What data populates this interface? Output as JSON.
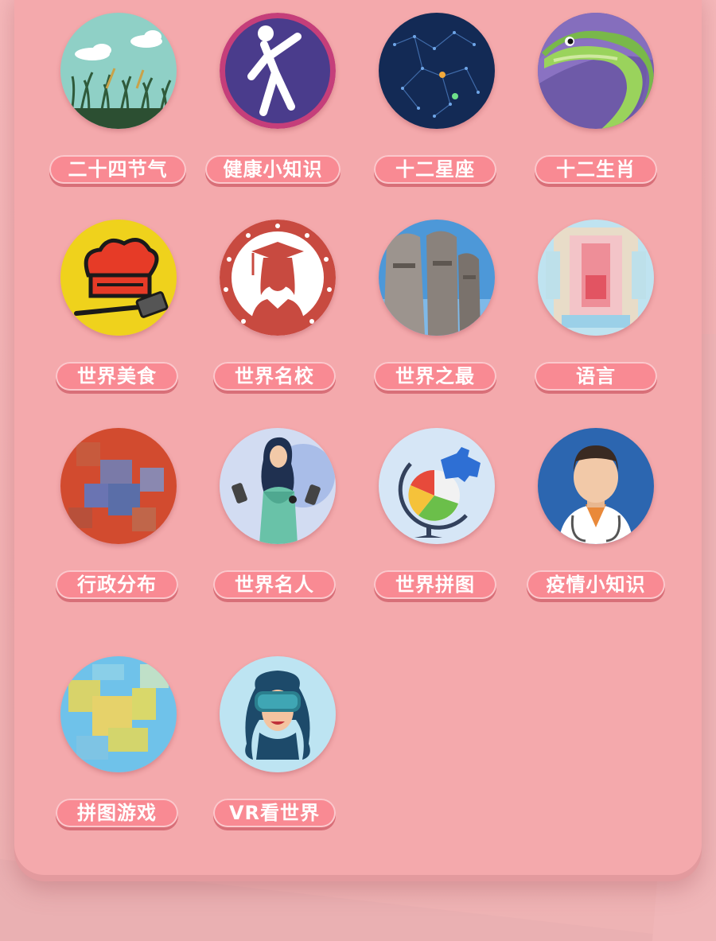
{
  "items": [
    {
      "label": "二十四节气",
      "icon": "solar-terms-icon"
    },
    {
      "label": "健康小知识",
      "icon": "health-tips-icon"
    },
    {
      "label": "十二星座",
      "icon": "constellation-icon"
    },
    {
      "label": "十二生肖",
      "icon": "zodiac-icon"
    },
    {
      "label": "世界美食",
      "icon": "world-food-icon"
    },
    {
      "label": "世界名校",
      "icon": "famous-school-icon"
    },
    {
      "label": "世界之最",
      "icon": "world-records-icon"
    },
    {
      "label": "语言",
      "icon": "language-icon"
    },
    {
      "label": "行政分布",
      "icon": "administrative-map-icon"
    },
    {
      "label": "世界名人",
      "icon": "celebrities-icon"
    },
    {
      "label": "世界拼图",
      "icon": "world-puzzle-icon"
    },
    {
      "label": "疫情小知识",
      "icon": "epidemic-tips-icon"
    },
    {
      "label": "拼图游戏",
      "icon": "puzzle-game-icon"
    },
    {
      "label": "VR看世界",
      "icon": "vr-world-icon"
    }
  ],
  "colors": {
    "background": "#f6b9bb",
    "panel": "#f4a9ac",
    "pill": "#f98a93"
  }
}
